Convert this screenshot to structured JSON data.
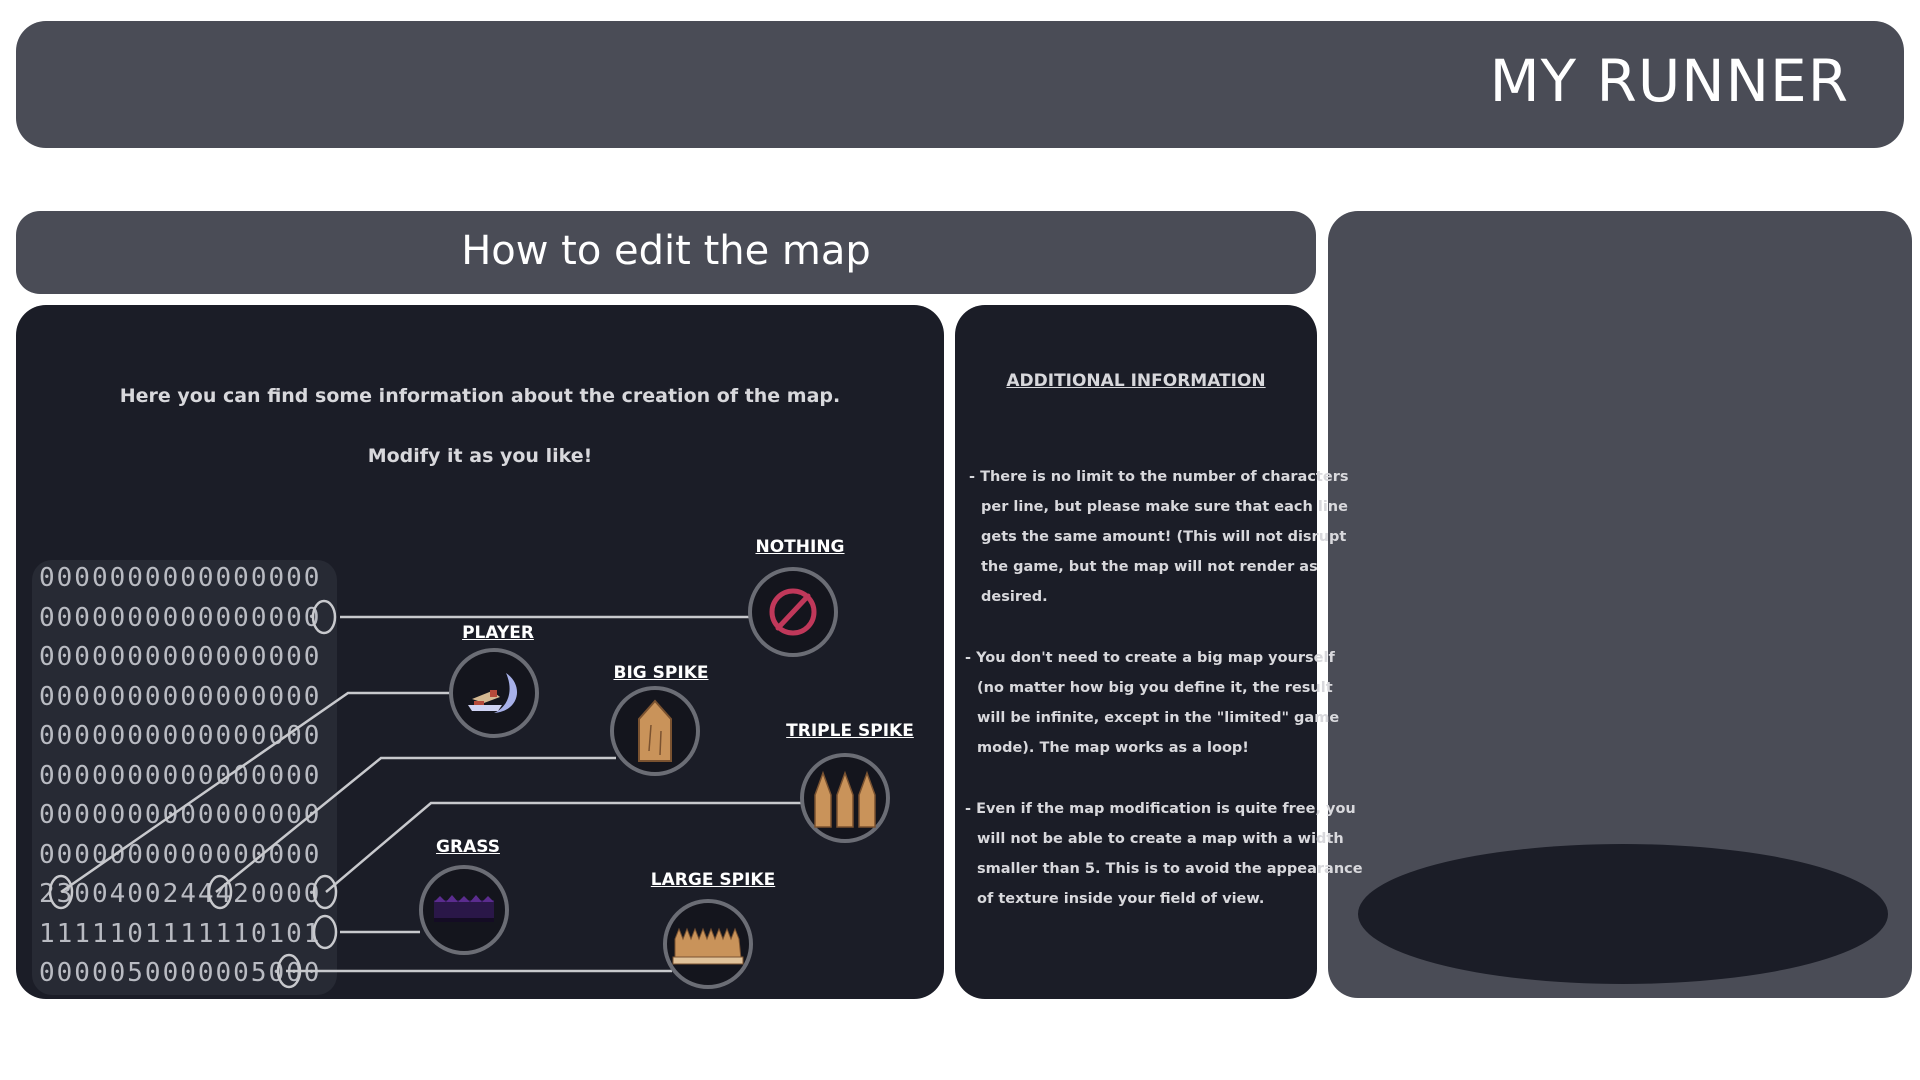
{
  "header": {
    "title": "MY RUNNER"
  },
  "section": {
    "title": "How to edit the map"
  },
  "intro": {
    "line1": "Here you can find some information about the creation of the map.",
    "line2": "Modify it as you like!"
  },
  "map_rows": [
    "0000000000000000",
    "0000000000000000",
    "0000000000000000",
    "0000000000000000",
    "0000000000000000",
    "0000000000000000",
    "0000000000000000",
    "0000000000000000",
    "2300400244420000",
    "1111101111110101",
    "0000050000005000"
  ],
  "legend": {
    "nothing": "NOTHING",
    "player": "PLAYER",
    "big_spike": "BIG SPIKE",
    "triple_spike": "TRIPLE SPIKE",
    "grass": "GRASS",
    "large_spike": "LARGE SPIKE"
  },
  "additional": {
    "title": "ADDITIONAL INFORMATION",
    "note1": [
      "- There is no limit to the number of characters",
      "per line, but please make sure that each line",
      "gets the same amount! (This will not disrupt",
      "the game, but the map will not render as",
      "desired."
    ],
    "note2": [
      "- You don't need to create a big map yourself",
      "(no matter how big you define it, the result",
      "will be infinite, except in the \"limited\" game",
      "mode). The map works as a loop!"
    ],
    "note3": [
      "- Even if the map modification is quite free, you",
      "will not be able to create a map with a width",
      "smaller than 5. This is to avoid the appearance",
      "of texture inside your field of view."
    ]
  },
  "colors": {
    "panel": "#4a4c56",
    "card": "#1b1d27",
    "forbidden_red": "#c0385a",
    "spike_wood": "#c9935a"
  },
  "icons": {
    "nothing": "forbidden-icon",
    "player": "runner-sprite-icon",
    "big_spike": "big-spike-icon",
    "triple_spike": "triple-spike-icon",
    "grass": "grass-icon",
    "large_spike": "large-spike-icon"
  }
}
